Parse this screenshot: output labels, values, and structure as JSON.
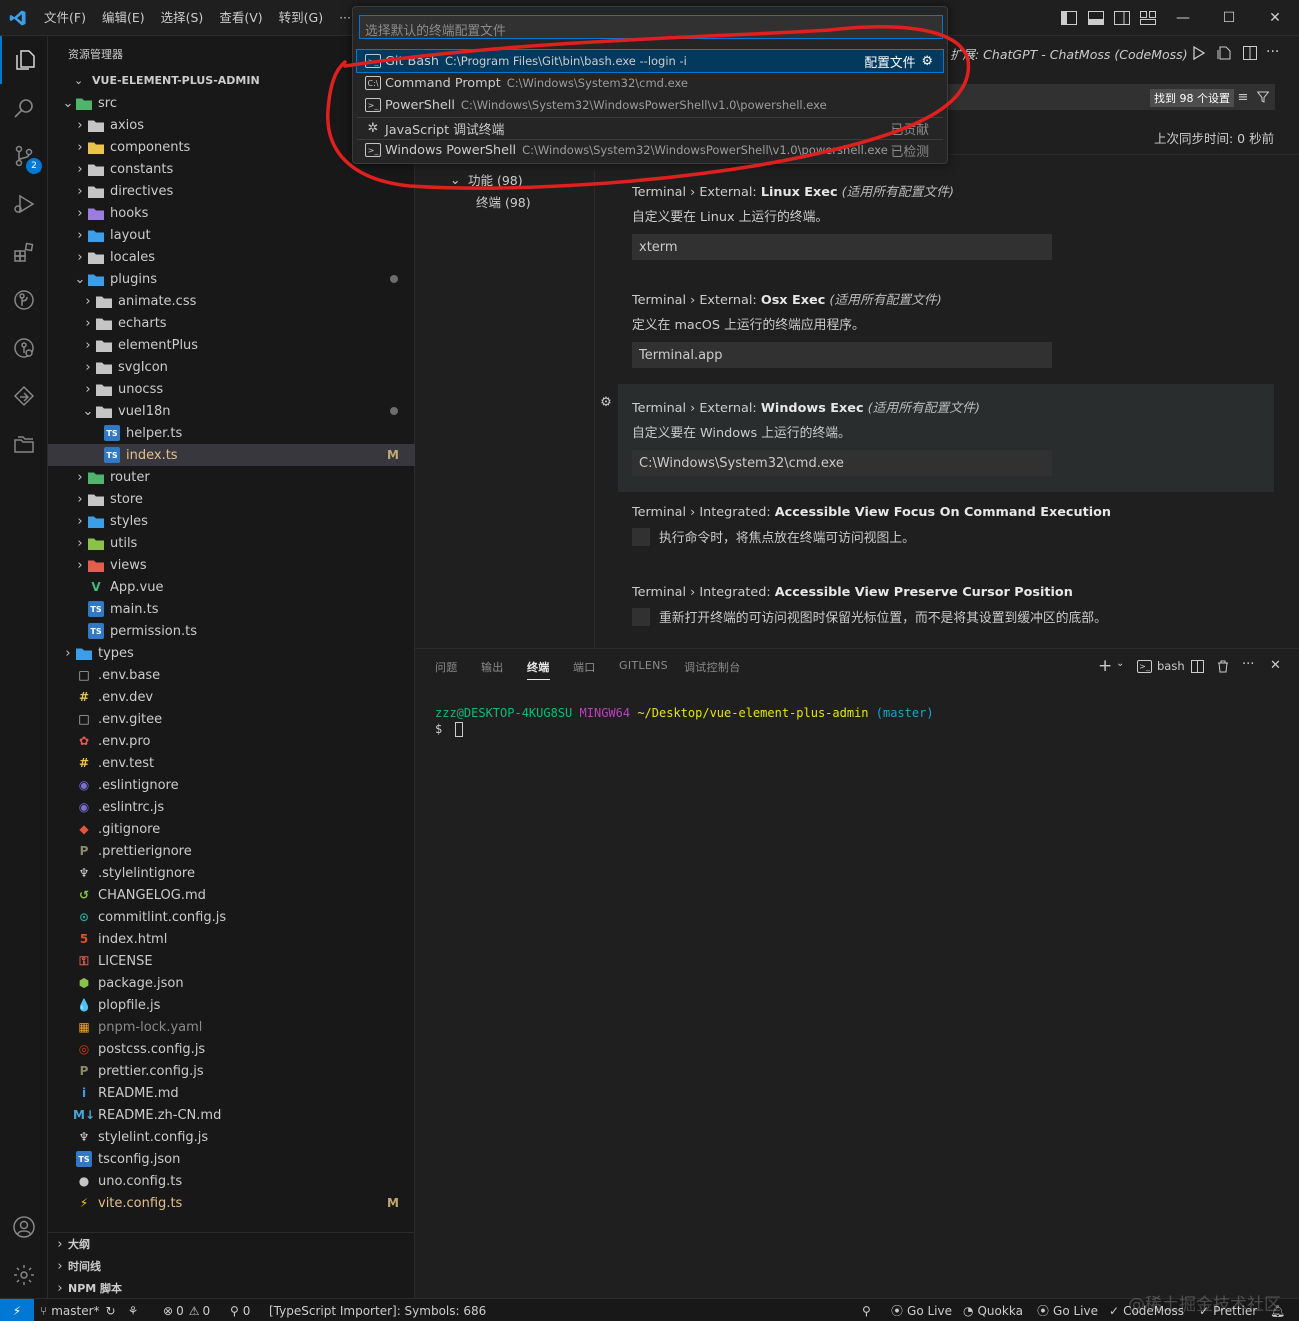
{
  "titlebar": {
    "menu": [
      "文件(F)",
      "编辑(E)",
      "选择(S)",
      "查看(V)",
      "转到(G)",
      "···"
    ],
    "window_title_fragment": "扩展: ChatGPT - ChatMoss (CodeMoss)"
  },
  "activity": {
    "scm_badge": "2"
  },
  "sidebar": {
    "header": "资源管理器",
    "header_more": "···",
    "root": "VUE-ELEMENT-PLUS-ADMIN",
    "tree": [
      {
        "name": "src",
        "depth": 1,
        "open": true,
        "icon": "folder-src-icon",
        "color": "#4fb56b"
      },
      {
        "name": "axios",
        "depth": 2,
        "open": false,
        "icon": "folder-icon",
        "color": "#c5c5c5"
      },
      {
        "name": "components",
        "depth": 2,
        "open": false,
        "icon": "folder-components-icon",
        "color": "#e9c34c"
      },
      {
        "name": "constants",
        "depth": 2,
        "open": false,
        "icon": "folder-icon",
        "color": "#c5c5c5"
      },
      {
        "name": "directives",
        "depth": 2,
        "open": false,
        "icon": "folder-icon",
        "color": "#c5c5c5"
      },
      {
        "name": "hooks",
        "depth": 2,
        "open": false,
        "icon": "folder-hooks-icon",
        "color": "#9b7de0"
      },
      {
        "name": "layout",
        "depth": 2,
        "open": false,
        "icon": "folder-layout-icon",
        "color": "#3c9ee8"
      },
      {
        "name": "locales",
        "depth": 2,
        "open": false,
        "icon": "folder-icon",
        "color": "#c5c5c5"
      },
      {
        "name": "plugins",
        "depth": 2,
        "open": true,
        "icon": "folder-plugins-icon",
        "color": "#3c9ee8",
        "dot": true
      },
      {
        "name": "animate.css",
        "depth": 3,
        "open": false,
        "icon": "folder-icon",
        "color": "#c5c5c5"
      },
      {
        "name": "echarts",
        "depth": 3,
        "open": false,
        "icon": "folder-icon",
        "color": "#c5c5c5"
      },
      {
        "name": "elementPlus",
        "depth": 3,
        "open": false,
        "icon": "folder-icon",
        "color": "#c5c5c5"
      },
      {
        "name": "svgIcon",
        "depth": 3,
        "open": false,
        "icon": "folder-icon",
        "color": "#c5c5c5"
      },
      {
        "name": "unocss",
        "depth": 3,
        "open": false,
        "icon": "folder-icon",
        "color": "#c5c5c5"
      },
      {
        "name": "vueI18n",
        "depth": 3,
        "open": true,
        "icon": "folder-open-icon",
        "color": "#c5c5c5",
        "dot": true
      },
      {
        "name": "helper.ts",
        "depth": 4,
        "file": true,
        "icon": "typescript-icon",
        "color": "#3178c6",
        "glyph": "TS"
      },
      {
        "name": "index.ts",
        "depth": 4,
        "file": true,
        "icon": "typescript-icon",
        "color": "#3178c6",
        "glyph": "TS",
        "mark": "M",
        "selected": true,
        "textColor": "#e2c08d"
      },
      {
        "name": "router",
        "depth": 2,
        "open": false,
        "icon": "folder-router-icon",
        "color": "#4fb56b"
      },
      {
        "name": "store",
        "depth": 2,
        "open": false,
        "icon": "folder-icon",
        "color": "#c5c5c5"
      },
      {
        "name": "styles",
        "depth": 2,
        "open": false,
        "icon": "folder-styles-icon",
        "color": "#3c9ee8"
      },
      {
        "name": "utils",
        "depth": 2,
        "open": false,
        "icon": "folder-utils-icon",
        "color": "#8bc34a"
      },
      {
        "name": "views",
        "depth": 2,
        "open": false,
        "icon": "folder-views-icon",
        "color": "#e35d4f"
      },
      {
        "name": "App.vue",
        "depth": 2,
        "file": true,
        "icon": "vue-icon",
        "color": "#41b883",
        "glyph": "V"
      },
      {
        "name": "main.ts",
        "depth": 2,
        "file": true,
        "icon": "typescript-icon",
        "color": "#3178c6",
        "glyph": "TS"
      },
      {
        "name": "permission.ts",
        "depth": 2,
        "file": true,
        "icon": "typescript-icon",
        "color": "#3178c6",
        "glyph": "TS"
      },
      {
        "name": "types",
        "depth": 1,
        "open": false,
        "icon": "folder-types-icon",
        "color": "#3c9ee8"
      },
      {
        "name": ".env.base",
        "depth": 1,
        "file": true,
        "icon": "file-icon",
        "color": "#c5c5c5",
        "glyph": "□"
      },
      {
        "name": ".env.dev",
        "depth": 1,
        "file": true,
        "icon": "env-icon",
        "color": "#e9c34c",
        "glyph": "#"
      },
      {
        "name": ".env.gitee",
        "depth": 1,
        "file": true,
        "icon": "file-icon",
        "color": "#c5c5c5",
        "glyph": "□"
      },
      {
        "name": ".env.pro",
        "depth": 1,
        "file": true,
        "icon": "env-pro-icon",
        "color": "#e35d4f",
        "glyph": "✿"
      },
      {
        "name": ".env.test",
        "depth": 1,
        "file": true,
        "icon": "env-icon",
        "color": "#e9c34c",
        "glyph": "#"
      },
      {
        "name": ".eslintignore",
        "depth": 1,
        "file": true,
        "icon": "eslint-icon",
        "color": "#7b6fd6",
        "glyph": "◉"
      },
      {
        "name": ".eslintrc.js",
        "depth": 1,
        "file": true,
        "icon": "eslint-icon",
        "color": "#7b6fd6",
        "glyph": "◉"
      },
      {
        "name": ".gitignore",
        "depth": 1,
        "file": true,
        "icon": "git-icon",
        "color": "#e5533c",
        "glyph": "◆"
      },
      {
        "name": ".prettierignore",
        "depth": 1,
        "file": true,
        "icon": "prettier-icon",
        "color": "#8a8a6c",
        "glyph": "P"
      },
      {
        "name": ".stylelintignore",
        "depth": 1,
        "file": true,
        "icon": "stylelint-icon",
        "color": "#d6d6d6",
        "glyph": "♆"
      },
      {
        "name": "CHANGELOG.md",
        "depth": 1,
        "file": true,
        "icon": "changelog-icon",
        "color": "#8bc34a",
        "glyph": "↺"
      },
      {
        "name": "commitlint.config.js",
        "depth": 1,
        "file": true,
        "icon": "commitlint-icon",
        "color": "#26a69a",
        "glyph": "⊙"
      },
      {
        "name": "index.html",
        "depth": 1,
        "file": true,
        "icon": "html-icon",
        "color": "#e44d26",
        "glyph": "5"
      },
      {
        "name": "LICENSE",
        "depth": 1,
        "file": true,
        "icon": "license-icon",
        "color": "#e35d4f",
        "glyph": "⚿"
      },
      {
        "name": "package.json",
        "depth": 1,
        "file": true,
        "icon": "nodejs-icon",
        "color": "#8bc34a",
        "glyph": "⬢"
      },
      {
        "name": "plopfile.js",
        "depth": 1,
        "file": true,
        "icon": "plop-icon",
        "color": "#3c9ee8",
        "glyph": "💧"
      },
      {
        "name": "pnpm-lock.yaml",
        "depth": 1,
        "file": true,
        "icon": "pnpm-icon",
        "color": "#f6a623",
        "glyph": "▦",
        "textColor": "#8b8b8b"
      },
      {
        "name": "postcss.config.js",
        "depth": 1,
        "file": true,
        "icon": "postcss-icon",
        "color": "#dd3a0a",
        "glyph": "◎"
      },
      {
        "name": "prettier.config.js",
        "depth": 1,
        "file": true,
        "icon": "prettier-icon",
        "color": "#8a8a6c",
        "glyph": "P"
      },
      {
        "name": "README.md",
        "depth": 1,
        "file": true,
        "icon": "info-icon",
        "color": "#3c9ee8",
        "glyph": "i"
      },
      {
        "name": "README.zh-CN.md",
        "depth": 1,
        "file": true,
        "icon": "markdown-icon",
        "color": "#4aa5d7",
        "glyph": "M↓"
      },
      {
        "name": "stylelint.config.js",
        "depth": 1,
        "file": true,
        "icon": "stylelint-icon",
        "color": "#d6d6d6",
        "glyph": "♆"
      },
      {
        "name": "tsconfig.json",
        "depth": 1,
        "file": true,
        "icon": "tsconfig-icon",
        "color": "#3178c6",
        "glyph": "TS"
      },
      {
        "name": "uno.config.ts",
        "depth": 1,
        "file": true,
        "icon": "unocss-icon",
        "color": "#c5c5c5",
        "glyph": "●"
      },
      {
        "name": "vite.config.ts",
        "depth": 1,
        "file": true,
        "icon": "vite-icon",
        "color": "#f7c600",
        "glyph": "⚡",
        "mark": "M",
        "textColor": "#e2c08d"
      }
    ],
    "sections": [
      "大纲",
      "时间线",
      "NPM 脚本"
    ]
  },
  "quickpick": {
    "placeholder": "选择默认的终端配置文件",
    "items": [
      {
        "label": "Git Bash",
        "path": "C:\\Program Files\\Git\\bin\\bash.exe --login -i",
        "right": "配置文件",
        "highlight": true
      },
      {
        "label": "Command Prompt",
        "path": "C:\\Windows\\System32\\cmd.exe",
        "right": ""
      },
      {
        "label": "PowerShell",
        "path": "C:\\Windows\\System32\\WindowsPowerShell\\v1.0\\powershell.exe",
        "right": ""
      },
      {
        "label": "JavaScript 调试终端",
        "path": "",
        "right": "已贡献"
      },
      {
        "label": "Windows PowerShell",
        "path": "C:\\Windows\\System32\\WindowsPowerShell\\v1.0\\powershell.exe",
        "right": "已检测"
      }
    ]
  },
  "settings": {
    "found": "找到 98 个设置",
    "sync": "上次同步时间: 0 秒前",
    "toc": [
      {
        "label": "功能 (98)",
        "depth": 0
      },
      {
        "label": "终端 (98)",
        "depth": 1
      }
    ],
    "items": [
      {
        "prefix": "Terminal › External: ",
        "name": "Linux Exec",
        "scope": "(适用所有配置文件)",
        "desc": "自定义要在 Linux 上运行的终端。",
        "value": "xterm",
        "type": "text"
      },
      {
        "prefix": "Terminal › External: ",
        "name": "Osx Exec",
        "scope": "(适用所有配置文件)",
        "desc": "定义在 macOS 上运行的终端应用程序。",
        "value": "Terminal.app",
        "type": "text"
      },
      {
        "prefix": "Terminal › External: ",
        "name": "Windows Exec",
        "scope": "(适用所有配置文件)",
        "desc": "自定义要在 Windows 上运行的终端。",
        "value": "C:\\Windows\\System32\\cmd.exe",
        "type": "text",
        "focused": true
      },
      {
        "prefix": "Terminal › Integrated: ",
        "name": "Accessible View Focus On Command Execution",
        "scope": "",
        "desc": "执行命令时，将焦点放在终端可访问视图上。",
        "value": "",
        "type": "checkbox"
      },
      {
        "prefix": "Terminal › Integrated: ",
        "name": "Accessible View Preserve Cursor Position",
        "scope": "",
        "desc": "重新打开终端的可访问视图时保留光标位置，而不是将其设置到缓冲区的底部。",
        "value": "",
        "type": "checkbox"
      }
    ]
  },
  "panel": {
    "tabs": [
      "问题",
      "输出",
      "终端",
      "端口",
      "GITLENS",
      "调试控制台"
    ],
    "active_tab": "终端",
    "shell_label": "bash",
    "prompt_user": "zzz@DESKTOP-4KUG8SU",
    "prompt_env": "MINGW64",
    "prompt_path": "~/Desktop/vue-element-plus-admin",
    "prompt_branch": "(master)",
    "prompt_symbol": "$"
  },
  "statusbar": {
    "remote": "⚡",
    "branch": "master*",
    "errors": "0",
    "warnings": "0",
    "ports": "0",
    "ts_importer": "[TypeScript Importer]: Symbols: 686",
    "right_items": [
      "Go Live",
      "Quokka",
      "Go Live",
      "CodeMoss",
      "Prettier"
    ]
  },
  "watermark": "@稀土掘金技术社区",
  "colors": {
    "accent": "#0078d4",
    "annotation_red": "#e0201e",
    "modified": "#e2c08d",
    "terminal_green": "#0dbc79",
    "terminal_purple": "#bc3fbc",
    "terminal_yellow": "#e5e510",
    "terminal_cyan": "#11a8cd"
  }
}
